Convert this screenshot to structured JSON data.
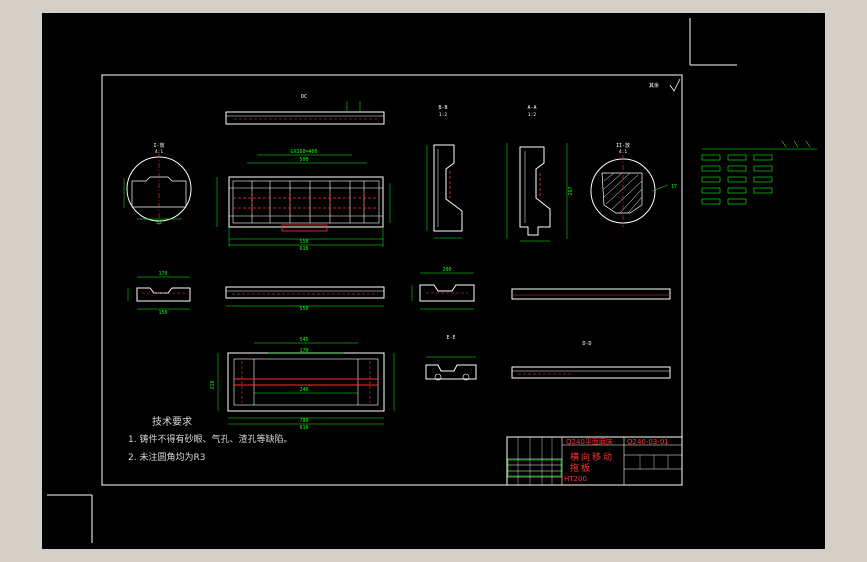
{
  "colors": {
    "background": "#d4d0c8",
    "canvas": "#000000",
    "line": "#ffffff",
    "dimension": "#00ff00",
    "hidden": "#ff3030",
    "text": "#d8d8d8"
  },
  "views": {
    "top_label": "DC",
    "section_b_label": "B-B",
    "section_b_scale": "1:2",
    "section_a_label": "A-A",
    "section_a_scale": "1:2",
    "detail1_label": "I-放",
    "detail1_scale": "4:1",
    "detail2_label": "II-放",
    "detail2_scale": "4:1",
    "section_d_label": "D-D",
    "section_e_label": "E-E"
  },
  "dimensions": {
    "overall_length": "GX160=400",
    "length_a": "500",
    "length_b": "550",
    "length_c": "616",
    "length_d": "780",
    "width_a": "545",
    "width_b": "170",
    "width_c": "240",
    "height_a": "218",
    "height_b": "267",
    "height_c": "200",
    "small_a": "170",
    "small_b": "150",
    "small_c": "32",
    "small_d": "17"
  },
  "surface_mark": "其余",
  "technical_requirements": {
    "title": "技术要求",
    "items": [
      "1. 铸件不得有砂眼、气孔、渣孔等缺陷。",
      "2. 未注圆角均为R3"
    ]
  },
  "title_block": {
    "machine": "Q240平面磨床",
    "drawing_no": "Q240-03-01",
    "part_name": "横向移动拖板",
    "material": "HT200"
  }
}
